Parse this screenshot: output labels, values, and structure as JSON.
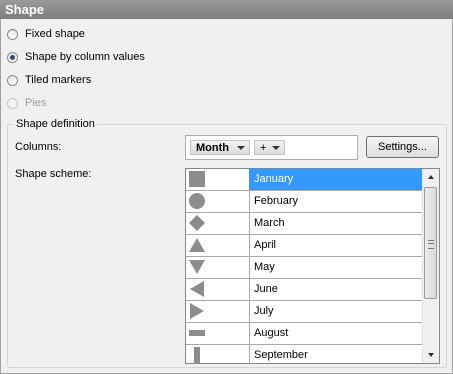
{
  "title": "Shape",
  "options": [
    {
      "label": "Fixed shape",
      "checked": false,
      "disabled": false
    },
    {
      "label": "Shape by column values",
      "checked": true,
      "disabled": false
    },
    {
      "label": "Tiled markers",
      "checked": false,
      "disabled": false
    },
    {
      "label": "Pies",
      "checked": false,
      "disabled": true
    }
  ],
  "definition": {
    "group_title": "Shape definition",
    "columns_label": "Columns:",
    "column_chip": "Month",
    "add_chip": "+",
    "settings_button": "Settings...",
    "scheme_label": "Shape scheme:"
  },
  "scheme": {
    "selected_index": 0,
    "items": [
      {
        "name": "January",
        "shape": "square-icon"
      },
      {
        "name": "February",
        "shape": "circle-icon"
      },
      {
        "name": "March",
        "shape": "diamond-icon"
      },
      {
        "name": "April",
        "shape": "triangle-up-icon"
      },
      {
        "name": "May",
        "shape": "triangle-down-icon"
      },
      {
        "name": "June",
        "shape": "triangle-left-icon"
      },
      {
        "name": "July",
        "shape": "triangle-right-icon"
      },
      {
        "name": "August",
        "shape": "horizontal-bar-icon"
      },
      {
        "name": "September",
        "shape": "vertical-bar-icon"
      }
    ]
  },
  "colors": {
    "accent": "#3399ff",
    "shape_fill": "#8c8c8c",
    "title_bar": "#8a8a8a"
  }
}
